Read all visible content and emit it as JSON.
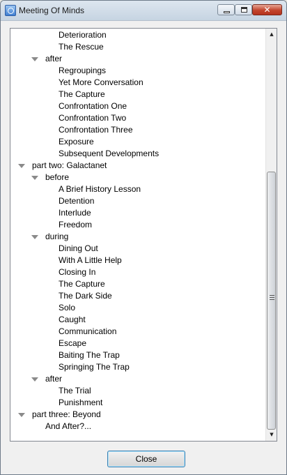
{
  "window": {
    "title": "Meeting Of Minds",
    "app_icon": "app-icon",
    "buttons": [
      "minimize-icon",
      "maximize-icon",
      "close-icon"
    ]
  },
  "tree": {
    "nodes": [
      {
        "label": "Deterioration",
        "level": 2,
        "expanded": null
      },
      {
        "label": "The Rescue",
        "level": 2,
        "expanded": null
      },
      {
        "label": "after",
        "level": 1,
        "expanded": true
      },
      {
        "label": "Regroupings",
        "level": 2,
        "expanded": null
      },
      {
        "label": "Yet More Conversation",
        "level": 2,
        "expanded": null
      },
      {
        "label": "The Capture",
        "level": 2,
        "expanded": null
      },
      {
        "label": "Confrontation One",
        "level": 2,
        "expanded": null
      },
      {
        "label": "Confrontation Two",
        "level": 2,
        "expanded": null
      },
      {
        "label": "Confrontation Three",
        "level": 2,
        "expanded": null
      },
      {
        "label": "Exposure",
        "level": 2,
        "expanded": null
      },
      {
        "label": "Subsequent Developments",
        "level": 2,
        "expanded": null
      },
      {
        "label": "part two: Galactanet",
        "level": 0,
        "expanded": true
      },
      {
        "label": "before",
        "level": 1,
        "expanded": true
      },
      {
        "label": "A Brief History Lesson",
        "level": 2,
        "expanded": null
      },
      {
        "label": "Detention",
        "level": 2,
        "expanded": null
      },
      {
        "label": "Interlude",
        "level": 2,
        "expanded": null
      },
      {
        "label": "Freedom",
        "level": 2,
        "expanded": null
      },
      {
        "label": "during",
        "level": 1,
        "expanded": true
      },
      {
        "label": "Dining Out",
        "level": 2,
        "expanded": null
      },
      {
        "label": "With A Little Help",
        "level": 2,
        "expanded": null
      },
      {
        "label": "Closing In",
        "level": 2,
        "expanded": null
      },
      {
        "label": "The Capture",
        "level": 2,
        "expanded": null
      },
      {
        "label": "The Dark Side",
        "level": 2,
        "expanded": null
      },
      {
        "label": "Solo",
        "level": 2,
        "expanded": null
      },
      {
        "label": "Caught",
        "level": 2,
        "expanded": null
      },
      {
        "label": "Communication",
        "level": 2,
        "expanded": null
      },
      {
        "label": "Escape",
        "level": 2,
        "expanded": null
      },
      {
        "label": "Baiting The Trap",
        "level": 2,
        "expanded": null
      },
      {
        "label": "Springing The Trap",
        "level": 2,
        "expanded": null
      },
      {
        "label": "after",
        "level": 1,
        "expanded": true
      },
      {
        "label": "The Trial",
        "level": 2,
        "expanded": null
      },
      {
        "label": "Punishment",
        "level": 2,
        "expanded": null
      },
      {
        "label": "part three: Beyond",
        "level": 0,
        "expanded": true
      },
      {
        "label": "And After?...",
        "level": 1,
        "expanded": null
      }
    ],
    "scroll_position": 0.6
  },
  "footer": {
    "close_label": "Close"
  }
}
